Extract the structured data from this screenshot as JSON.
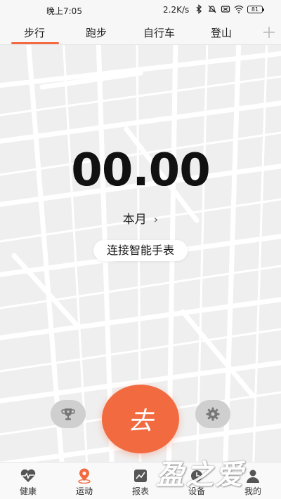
{
  "status_bar": {
    "time": "晚上7:05",
    "speed": "2.2K/s",
    "battery": "81"
  },
  "tabs": [
    {
      "label": "步行",
      "active": true
    },
    {
      "label": "跑步",
      "active": false
    },
    {
      "label": "自行车",
      "active": false
    },
    {
      "label": "登山",
      "active": false
    }
  ],
  "main": {
    "distance": "00.00",
    "period_label": "本月",
    "connect_label": "连接智能手表",
    "go_label": "去"
  },
  "bottom_nav": [
    {
      "label": "健康",
      "icon": "heart-pulse-icon",
      "active": false
    },
    {
      "label": "运动",
      "icon": "location-pin-icon",
      "active": true
    },
    {
      "label": "报表",
      "icon": "chart-icon",
      "active": false
    },
    {
      "label": "设备",
      "icon": "clock-icon",
      "active": false
    },
    {
      "label": "我的",
      "icon": "user-icon",
      "active": false
    }
  ],
  "watermark": "盈之爱",
  "colors": {
    "accent": "#f26a3f",
    "map_bg": "#f2f2f2",
    "map_road": "#ffffff",
    "secondary_button": "#cfcfcf"
  }
}
